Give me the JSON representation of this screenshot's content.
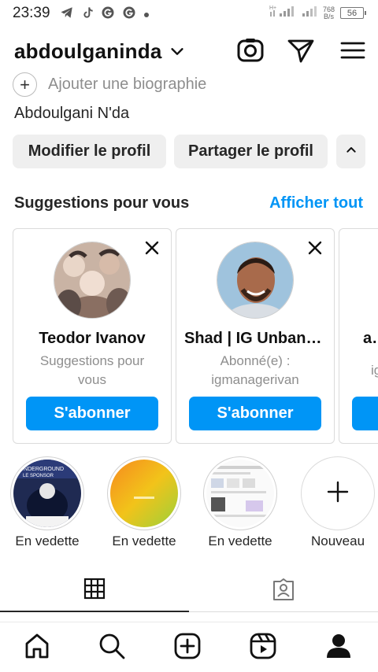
{
  "status_bar": {
    "time": "23:39",
    "net_speed_value": "768",
    "net_speed_unit": "B/s",
    "battery": "56",
    "notification_icons": [
      "telegram-icon",
      "tiktok-icon",
      "g-icon",
      "g-icon",
      "dot-icon"
    ]
  },
  "header": {
    "username": "abdoulganinda",
    "icons": [
      "chevron-down-icon",
      "threads-icon",
      "send-icon",
      "menu-icon"
    ]
  },
  "profile": {
    "bio_placeholder": "Ajouter une biographie",
    "full_name": "Abdoulgani N'da"
  },
  "actions": {
    "edit_label": "Modifier le profil",
    "share_label": "Partager le profil"
  },
  "suggestions": {
    "title": "Suggestions pour vous",
    "see_all": "Afficher tout",
    "follow_label": "S'abonner",
    "cards": [
      {
        "name": "Teodor Ivanov",
        "subtitle": "Suggestions pour vous"
      },
      {
        "name": "Shad | IG Unbanning",
        "subtitle": "Abonné(e) : igmanagerivan"
      },
      {
        "name": "av",
        "subtitle": "ig"
      }
    ]
  },
  "highlights": [
    {
      "label": "En vedette"
    },
    {
      "label": "En vedette"
    },
    {
      "label": "En vedette"
    },
    {
      "label": "Nouveau"
    }
  ],
  "colors": {
    "accent": "#0095f6",
    "button_bg": "#efefef",
    "text": "#262626",
    "muted": "#8e8e8e"
  }
}
